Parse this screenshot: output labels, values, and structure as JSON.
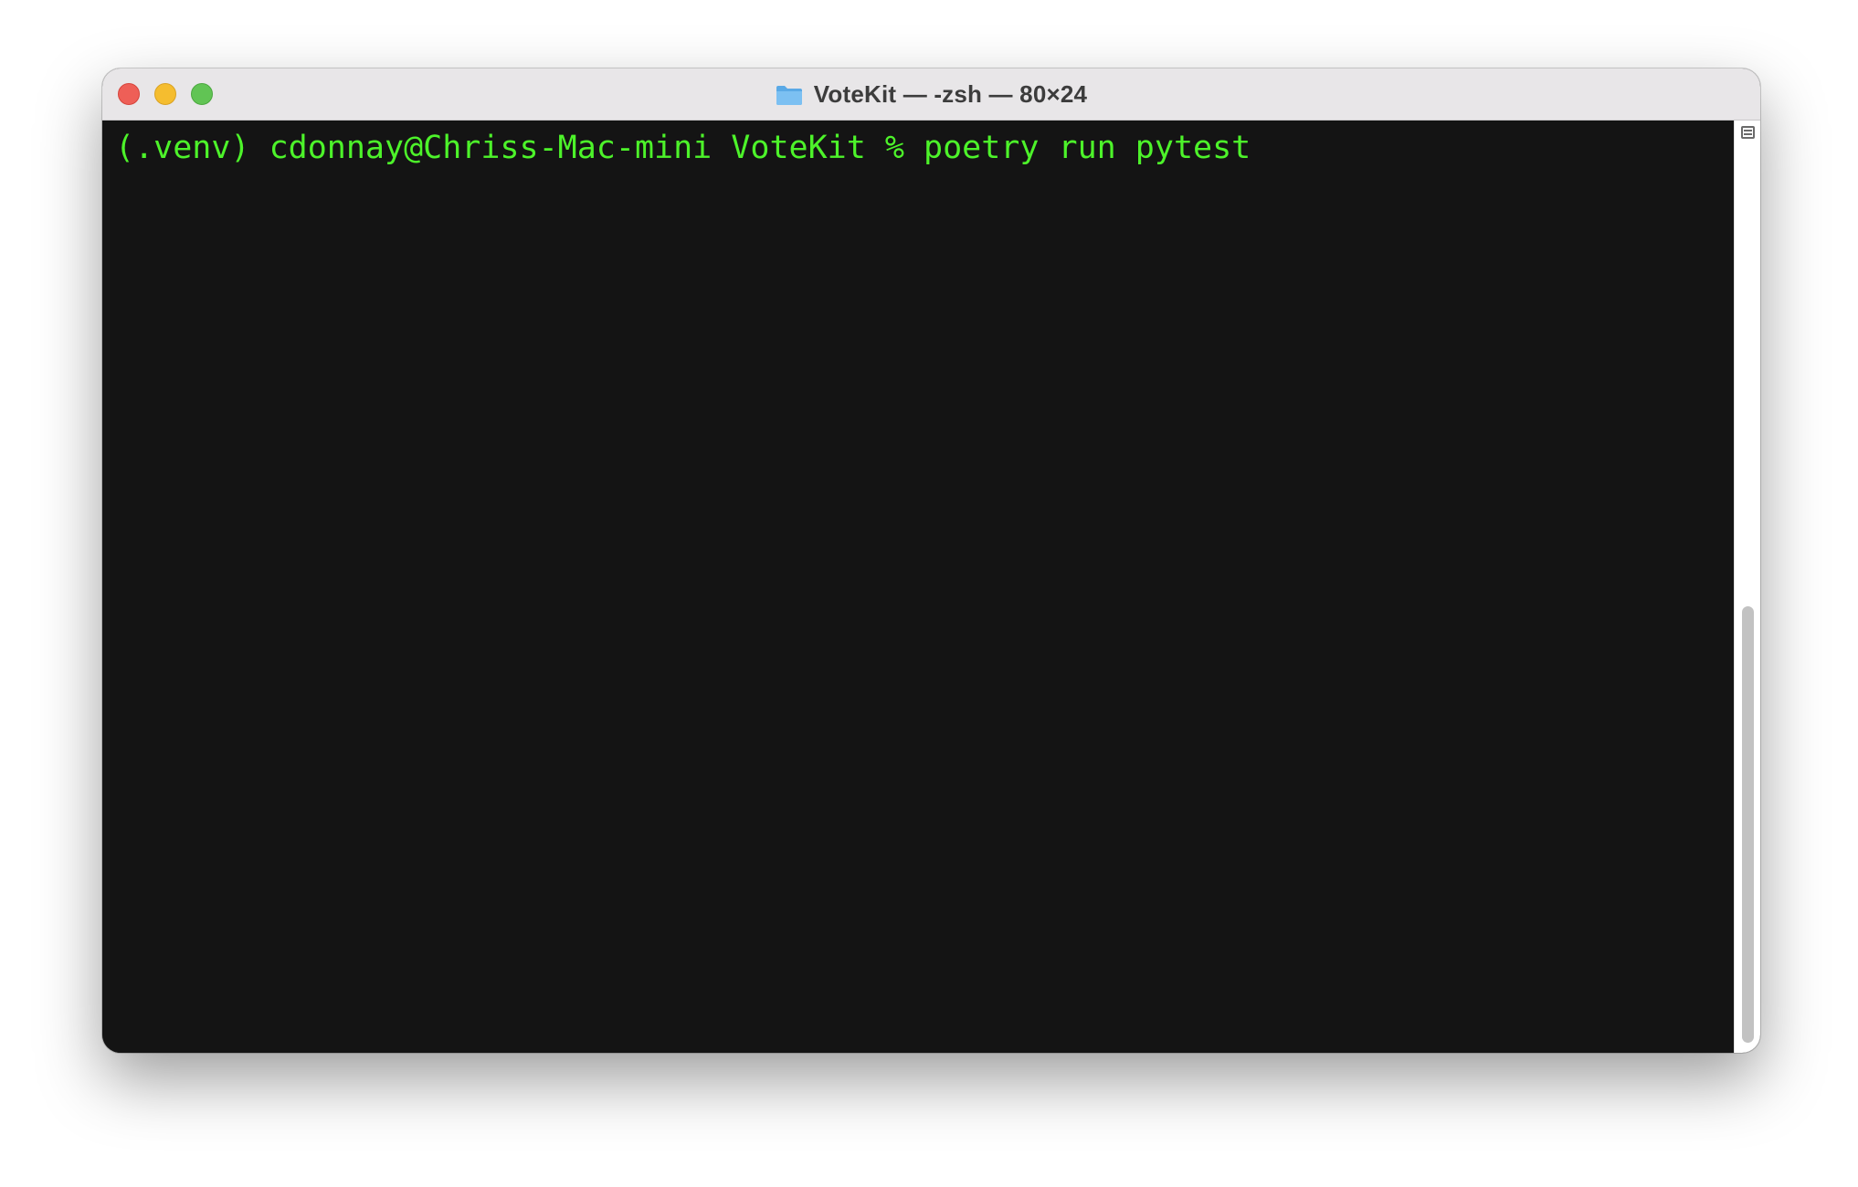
{
  "window": {
    "title": "VoteKit — -zsh — 80×24",
    "title_icon": "folder-icon",
    "controls": [
      "close",
      "minimize",
      "zoom"
    ]
  },
  "terminal": {
    "lines": [
      "(.venv) cdonnay@Chriss-Mac-mini VoteKit % poetry run pytest"
    ],
    "text_color": "#4df32a",
    "background_color": "#141414"
  },
  "colors": {
    "close": "#ee5f57",
    "minimize": "#f5bd2f",
    "zoom": "#61c454",
    "titlebar": "#e8e6e8"
  }
}
